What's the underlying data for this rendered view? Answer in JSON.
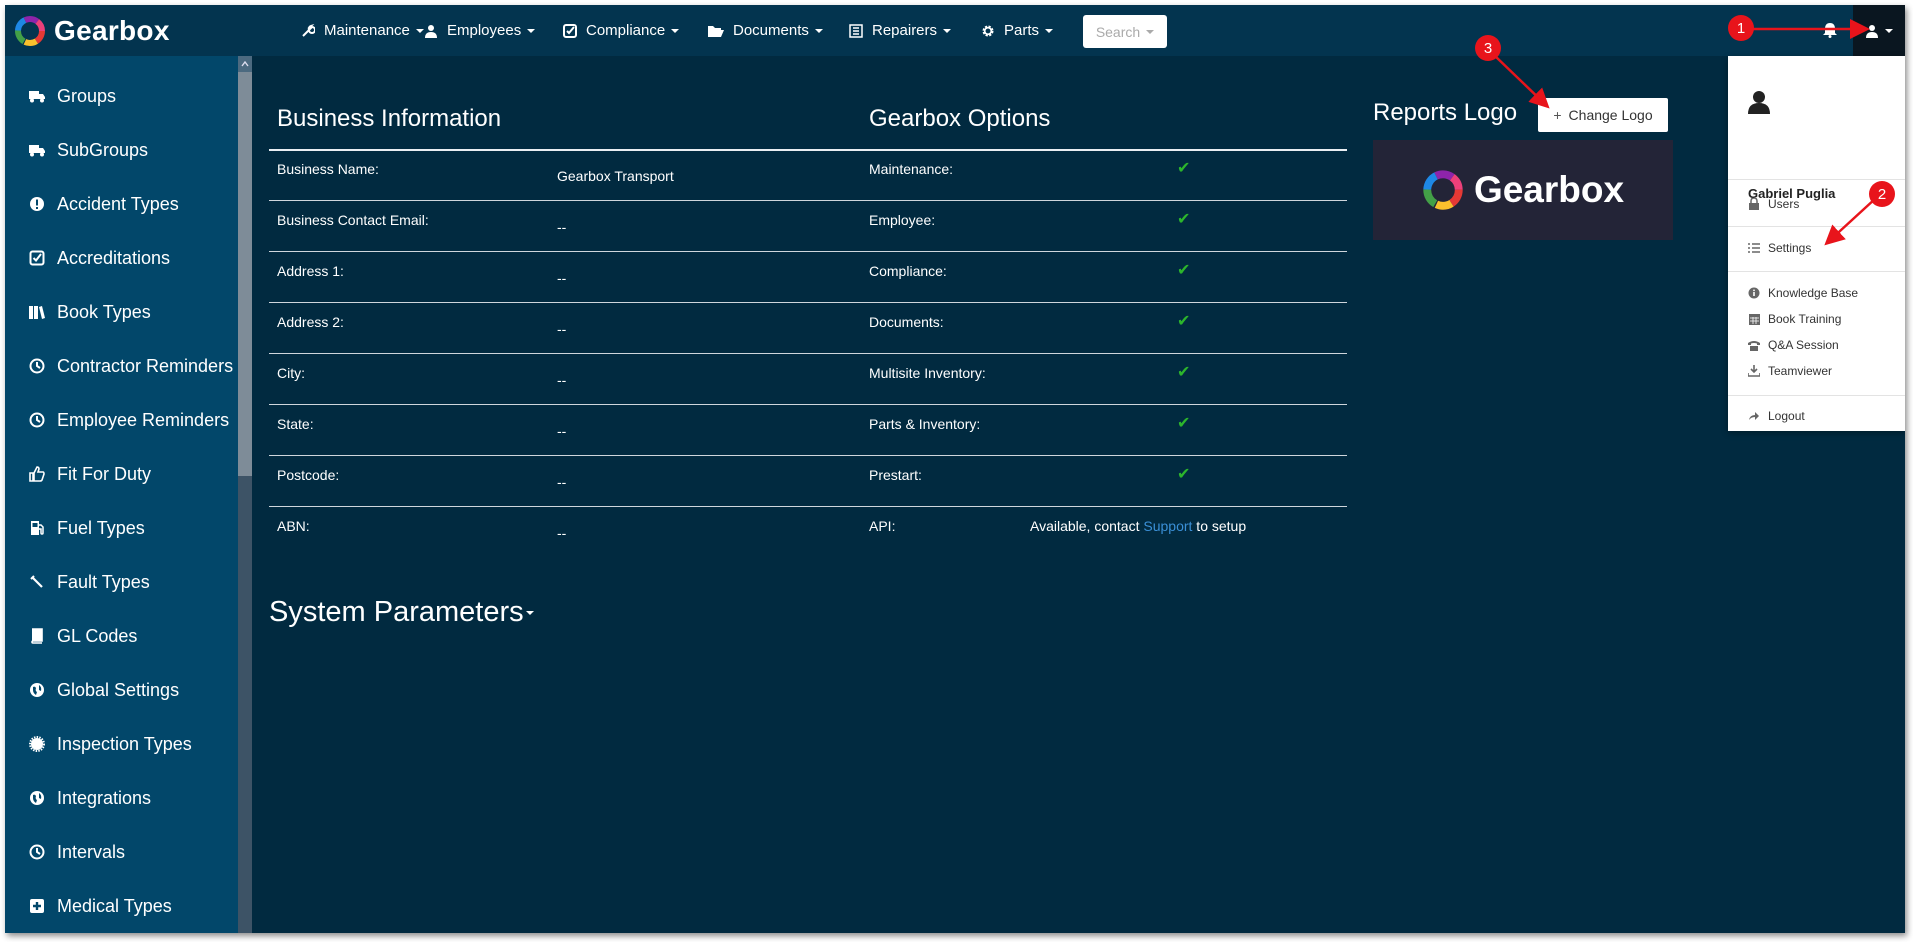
{
  "brand": {
    "name": "Gearbox"
  },
  "topnav": {
    "items": [
      {
        "label": "Maintenance",
        "icon": "wrench-icon"
      },
      {
        "label": "Employees",
        "icon": "user-icon"
      },
      {
        "label": "Compliance",
        "icon": "check-square-icon"
      },
      {
        "label": "Documents",
        "icon": "folder-open-icon"
      },
      {
        "label": "Repairers",
        "icon": "list-alt-icon"
      },
      {
        "label": "Parts",
        "icon": "cog-icon"
      }
    ],
    "search_label": "Search"
  },
  "sidebar": {
    "items": [
      {
        "label": "Groups",
        "icon": "truck-icon"
      },
      {
        "label": "SubGroups",
        "icon": "truck-icon"
      },
      {
        "label": "Accident Types",
        "icon": "exclamation-circle-icon"
      },
      {
        "label": "Accreditations",
        "icon": "check-square-icon"
      },
      {
        "label": "Book Types",
        "icon": "books-icon"
      },
      {
        "label": "Contractor Reminders",
        "icon": "clock-icon"
      },
      {
        "label": "Employee Reminders",
        "icon": "clock-icon"
      },
      {
        "label": "Fit For Duty",
        "icon": "thumbs-up-icon"
      },
      {
        "label": "Fuel Types",
        "icon": "fuel-pump-icon"
      },
      {
        "label": "Fault Types",
        "icon": "wrench-icon"
      },
      {
        "label": "GL Codes",
        "icon": "book-icon"
      },
      {
        "label": "Global Settings",
        "icon": "globe-icon"
      },
      {
        "label": "Inspection Types",
        "icon": "certificate-icon"
      },
      {
        "label": "Integrations",
        "icon": "globe-icon"
      },
      {
        "label": "Intervals",
        "icon": "clock-icon"
      },
      {
        "label": "Medical Types",
        "icon": "plus-square-icon"
      }
    ]
  },
  "business": {
    "title": "Business Information",
    "rows": [
      {
        "label": "Business Name:",
        "value": "Gearbox Transport"
      },
      {
        "label": "Business Contact Email:",
        "value": "--"
      },
      {
        "label": "Address 1:",
        "value": "--"
      },
      {
        "label": "Address 2:",
        "value": "--"
      },
      {
        "label": "City:",
        "value": "--"
      },
      {
        "label": "State:",
        "value": "--"
      },
      {
        "label": "Postcode:",
        "value": "--"
      },
      {
        "label": "ABN:",
        "value": "--"
      }
    ]
  },
  "options": {
    "title": "Gearbox Options",
    "rows": [
      {
        "label": "Maintenance:",
        "enabled": true
      },
      {
        "label": "Employee:",
        "enabled": true
      },
      {
        "label": "Compliance:",
        "enabled": true
      },
      {
        "label": "Documents:",
        "enabled": true
      },
      {
        "label": "Multisite Inventory:",
        "enabled": true
      },
      {
        "label": "Parts & Inventory:",
        "enabled": true
      },
      {
        "label": "Prestart:",
        "enabled": true
      }
    ],
    "api": {
      "label": "API:",
      "text_before": "Available, contact ",
      "link": "Support",
      "text_after": " to setup"
    }
  },
  "system": {
    "title": "System Parameters"
  },
  "reports_logo": {
    "title": "Reports Logo",
    "button_label": "Change Logo",
    "logo_text": "Gearbox"
  },
  "user_menu": {
    "name": "Gabriel Puglia",
    "items": [
      {
        "label": "Users",
        "icon": "lock-icon"
      },
      {
        "label": "Settings",
        "icon": "list-icon"
      },
      {
        "label": "Knowledge Base",
        "icon": "info-circle-icon"
      },
      {
        "label": "Book Training",
        "icon": "calendar-icon"
      },
      {
        "label": "Q&A Session",
        "icon": "phone-icon"
      },
      {
        "label": "Teamviewer",
        "icon": "download-icon"
      },
      {
        "label": "Logout",
        "icon": "share-icon"
      }
    ]
  },
  "annotations": {
    "badges": [
      "1",
      "2",
      "3"
    ]
  },
  "colors": {
    "nav_bg": "#03344f",
    "sidebar_bg": "#02476a",
    "main_bg": "#012a40",
    "check": "#2cb52c",
    "link": "#3a8fd6",
    "badge": "#e8141b"
  }
}
